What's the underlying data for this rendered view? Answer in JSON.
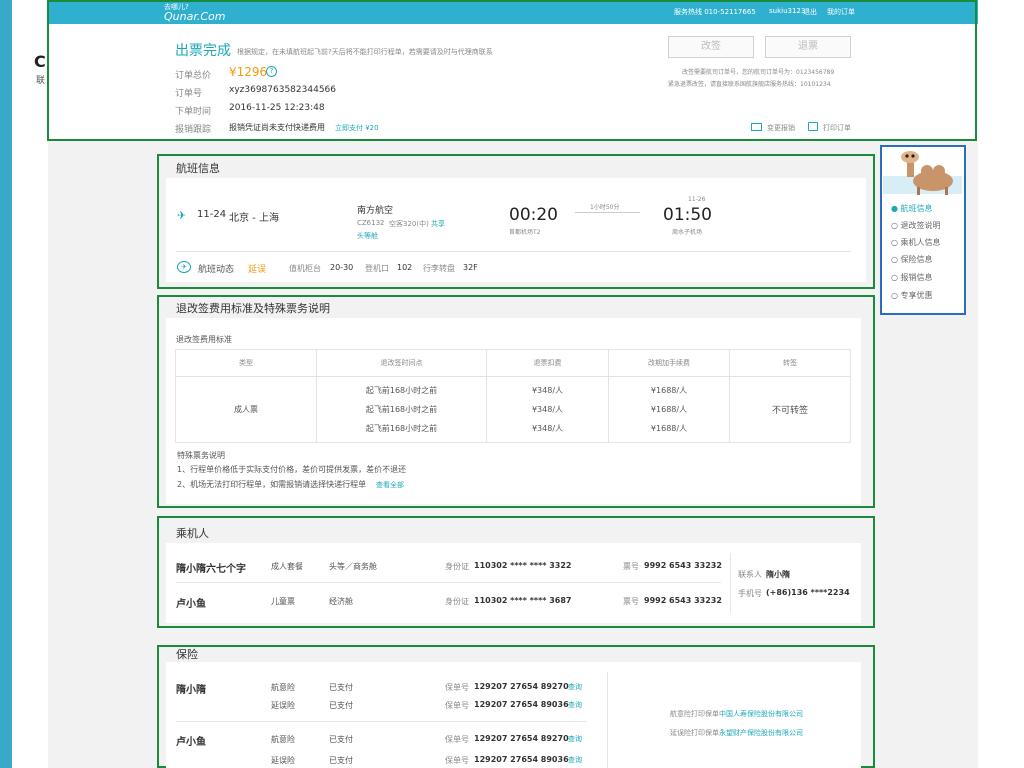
{
  "header": {
    "logo_cn": "去哪儿?",
    "logo_en": "Qunar.Com",
    "hotline": "服务热线 010-52117665",
    "username": "sukiu3123",
    "logout": "退出",
    "my_orders": "我的订单"
  },
  "order": {
    "status": "出票完成",
    "notice": "根据规定，在未填航班起飞前?天后将不能打印行程单，若需要请及时与代理商联系",
    "total_label": "订单总价",
    "total_value": "¥1296",
    "number_label": "订单号",
    "number_value": "xyz369876358234456​6",
    "time_label": "下单时间",
    "time_value": "2016-11-25  12:23:48",
    "reimburse_label": "报销跟踪",
    "reimburse_value": "报销凭证尚未支付快递费用",
    "reimburse_pay": "立即支付 ¥20",
    "change_btn": "改签",
    "refund_btn": "退票",
    "note1": "改签需要航司订单号，您的航司订单号为：0123456789",
    "note2": "紧急退票改签，请直接联系国航旗舰店服务热线：10101234",
    "modify_voucher": "变更报销",
    "print_order": "打印订单"
  },
  "flight": {
    "section_title": "航班信息",
    "date": "11-24",
    "route": "北京 - 上海",
    "airline": "南方航空",
    "flight_no": "CZ6132",
    "aircraft": "空客320(中)",
    "share": "共享",
    "cabin": "头等舱",
    "depart_time": "00:20",
    "depart_airport": "首都机场T2",
    "duration": "1小时50分",
    "arrive_date": "11-26",
    "arrive_time": "01:50",
    "arrive_airport": "周水子机场",
    "status_label": "航班动态",
    "status_value": "延误",
    "counter_label": "值机柜台",
    "counter_value": "20-30",
    "gate_label": "登机口",
    "gate_value": "102",
    "baggage_label": "行李转盘",
    "baggage_value": "32F"
  },
  "fees": {
    "section_title": "退改签费用标准及特殊票务说明",
    "sub_title": "退改签费用标准",
    "headers": [
      "类型",
      "退改签时间点",
      "退票扣费",
      "改期加手续费",
      "转签"
    ],
    "type": "成人票",
    "rows": [
      {
        "time": "起飞前168小时之前",
        "refund": "¥348/人",
        "change": "¥1688/人"
      },
      {
        "time": "起飞前168小时之前",
        "refund": "¥348/人",
        "change": "¥1688/人"
      },
      {
        "time": "起飞前168小时之前",
        "refund": "¥348/人",
        "change": "¥1688/人"
      }
    ],
    "transfer": "不可转签",
    "special_title": "特殊票务说明",
    "special_1": "1、行程单价格低于实际支付价格，差价可提供发票，差价不退还",
    "special_2": "2、机场无法打印行程单，如需报销请选择快递行程单",
    "view_all": "查看全部"
  },
  "passengers": {
    "section_title": "乘机人",
    "list": [
      {
        "name": "隋小隋六七个字",
        "ticket_type": "成人套餐",
        "cabin": "头等／商务舱",
        "id_label": "身份证",
        "id": "110302 **** **** 3322",
        "ticket_label": "票号",
        "ticket_no": "9992 6543 33232"
      },
      {
        "name": "卢小鱼",
        "ticket_type": "儿童票",
        "cabin": "经济舱",
        "id_label": "身份证",
        "id": "110302 **** **** 3687",
        "ticket_label": "票号",
        "ticket_no": "9992 6543 33232"
      }
    ],
    "contact_label": "联系人",
    "contact_name": "隋小隋",
    "phone_label": "手机号",
    "phone_value": "(+86)136 ****2234"
  },
  "insurance": {
    "section_title": "保险",
    "people": [
      {
        "name": "隋小隋",
        "items": [
          {
            "type": "航意险",
            "status": "已支付",
            "policy_label": "保单号",
            "policy": "129207 27654 89270",
            "query": "查询"
          },
          {
            "type": "延误险",
            "status": "已支付",
            "policy_label": "保单号",
            "policy": "129207 27654 89036",
            "query": "查询"
          }
        ]
      },
      {
        "name": "卢小鱼",
        "items": [
          {
            "type": "航意险",
            "status": "已支付",
            "policy_label": "保单号",
            "policy": "129207 27654 89270",
            "query": "查询"
          },
          {
            "type": "延误险",
            "status": "已支付",
            "policy_label": "保单号",
            "policy": "129207 27654 89036",
            "query": "查询"
          }
        ]
      }
    ],
    "note1_prefix": "航意险打印保单",
    "note1_link": "中国人寿保险股份有限公司",
    "note2_prefix": "延误险打印保单",
    "note2_link": "永望财产保险股份有限公司"
  },
  "sidenav": {
    "items": [
      "航班信息",
      "退改签说明",
      "乘机人信息",
      "保险信息",
      "报销信息",
      "专享优惠"
    ]
  },
  "colors": {
    "accent": "#1ba9ba",
    "orange": "#f39c12",
    "topbar": "#2fb0cf"
  }
}
